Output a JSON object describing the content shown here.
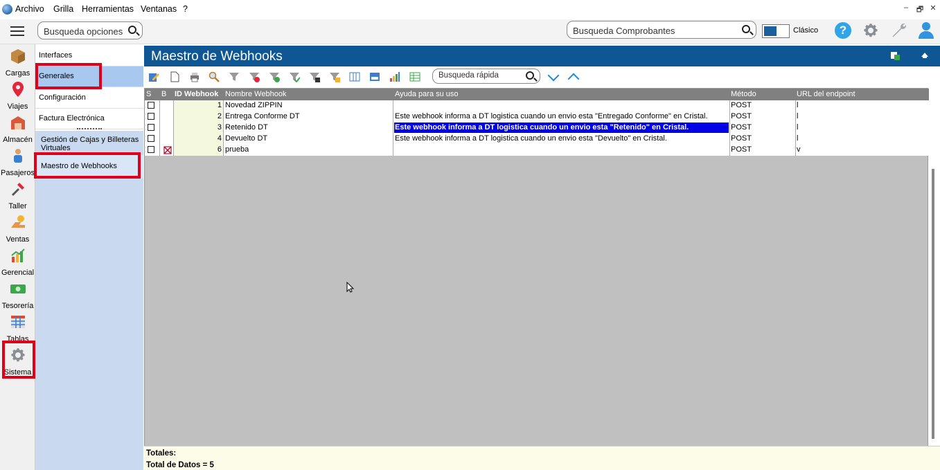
{
  "menubar": {
    "items": [
      "Archivo",
      "Grilla",
      "Herramientas",
      "Ventanas",
      "?"
    ],
    "win_controls": [
      "–",
      "🗗",
      "✕"
    ]
  },
  "topbar": {
    "search_options_placeholder": "Busqueda opciones",
    "search_vouchers_placeholder": "Busqueda Comprobantes",
    "mode_label": "Clásico",
    "help_glyph": "?"
  },
  "rail": {
    "items": [
      "Cargas",
      "Viajes",
      "Almacén",
      "Pasajeros",
      "Taller",
      "Ventas",
      "Gerencial",
      "Tesorería",
      "Tablas",
      "Sistema"
    ]
  },
  "submenu": {
    "items": [
      "Interfaces",
      "Generales",
      "Configuración",
      "Factura Electrónica"
    ],
    "sub_items": [
      "Gestión de Cajas y Billeteras Virtuales",
      "Maestro de Webhooks"
    ]
  },
  "main": {
    "title": "Maestro de Webhooks",
    "quick_search_placeholder": "Busqueda rápida"
  },
  "grid": {
    "columns": [
      "S",
      "B",
      "ID Webhook",
      "Nombre Webhook",
      "Ayuda para su uso",
      "Método",
      "URL del endpoint"
    ],
    "rows": [
      {
        "id": "1",
        "name": "Novedad ZIPPIN",
        "help": "",
        "method": "POST",
        "url": "l"
      },
      {
        "id": "2",
        "name": "Entrega Conforme DT",
        "help": "Este webhook informa a DT logistica cuando un envio esta \"Entregado Conforme\" en Cristal.",
        "method": "POST",
        "url": "l"
      },
      {
        "id": "3",
        "name": "Retenido DT",
        "help": "Este webhook informa a DT logistica cuando un envio esta \"Retenido\" en Cristal.",
        "method": "POST",
        "url": "l"
      },
      {
        "id": "4",
        "name": "Devuelto DT",
        "help": "Este webhook informa a DT logistica cuando un envio esta \"Devuelto\" en Cristal.",
        "method": "POST",
        "url": "l"
      },
      {
        "id": "6",
        "name": "prueba",
        "help": "",
        "method": "POST",
        "url": "v"
      }
    ]
  },
  "totals": {
    "label": "Totales:",
    "count": "Total de Datos = 5"
  },
  "colors": {
    "accent": "#0e5694",
    "selection": "#0000e6",
    "highlight_box": "#e0001a",
    "submenu_bg": "#c9daf0"
  }
}
